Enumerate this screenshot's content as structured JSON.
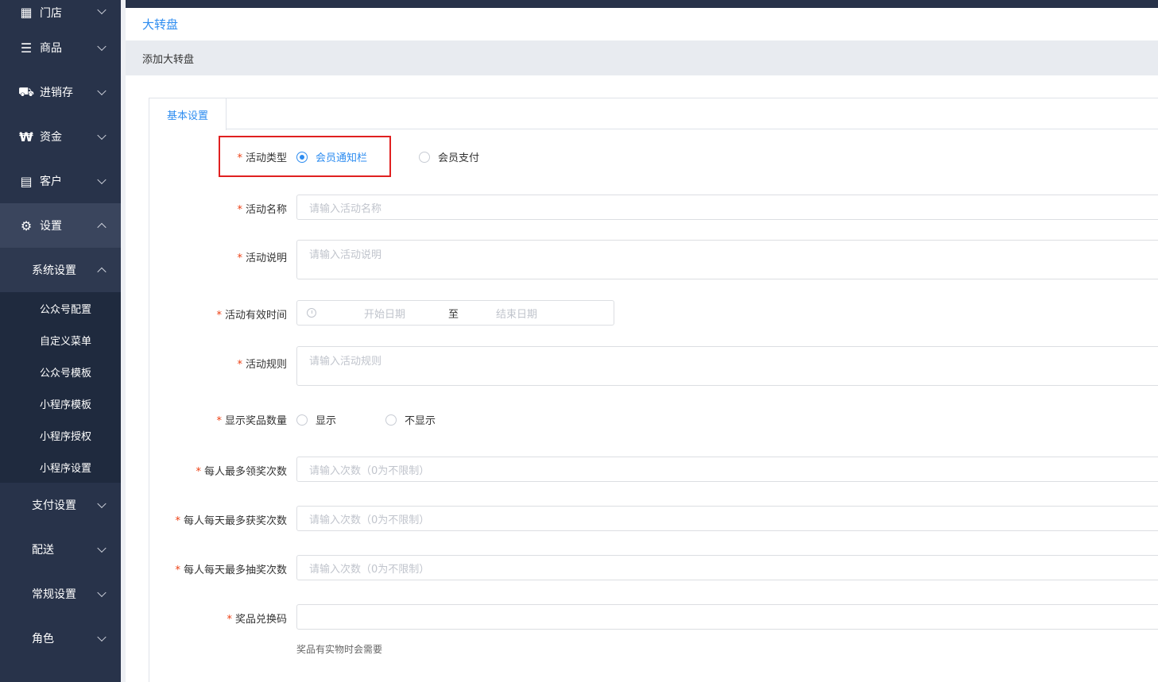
{
  "sidebar": {
    "items": [
      {
        "label": "门店",
        "icon": "building-icon"
      },
      {
        "label": "商品",
        "icon": "list-icon"
      },
      {
        "label": "进销存",
        "icon": "truck-icon"
      },
      {
        "label": "资金",
        "icon": "won-icon"
      },
      {
        "label": "客户",
        "icon": "id-card-icon"
      },
      {
        "label": "设置",
        "icon": "gear-icon"
      }
    ],
    "system_settings": "系统设置",
    "system_children": [
      "公众号配置",
      "自定义菜单",
      "公众号模板",
      "小程序模板",
      "小程序授权",
      "小程序设置"
    ],
    "more": [
      "支付设置",
      "配送",
      "常规设置",
      "角色"
    ]
  },
  "header": {
    "title": "大转盘",
    "subtitle": "添加大转盘"
  },
  "tabs": [
    "基本设置"
  ],
  "form": {
    "activity_type": {
      "label": "活动类型",
      "options": [
        "会员通知栏",
        "会员支付"
      ],
      "selected": 0
    },
    "activity_name": {
      "label": "活动名称",
      "placeholder": "请输入活动名称"
    },
    "activity_desc": {
      "label": "活动说明",
      "placeholder": "请输入活动说明"
    },
    "activity_time": {
      "label": "活动有效时间",
      "start": "开始日期",
      "sep": "至",
      "end": "结束日期"
    },
    "activity_rules": {
      "label": "活动规则",
      "placeholder": "请输入活动规则"
    },
    "show_prize_count": {
      "label": "显示奖品数量",
      "options": [
        "显示",
        "不显示"
      ]
    },
    "max_per_person": {
      "label": "每人最多领奖次数",
      "placeholder": "请输入次数（0为不限制）"
    },
    "max_win_per_day": {
      "label": "每人每天最多获奖次数",
      "placeholder": "请输入次数（0为不限制）"
    },
    "max_draw_per_day": {
      "label": "每人每天最多抽奖次数",
      "placeholder": "请输入次数（0为不限制）"
    },
    "redeem_code": {
      "label": "奖品兑换码",
      "hint": "奖品有实物时会需要"
    }
  },
  "colors": {
    "accent": "#2d8cf0",
    "required": "#ed4014",
    "sidebar": "#28334a",
    "highlight": "#e02020"
  }
}
